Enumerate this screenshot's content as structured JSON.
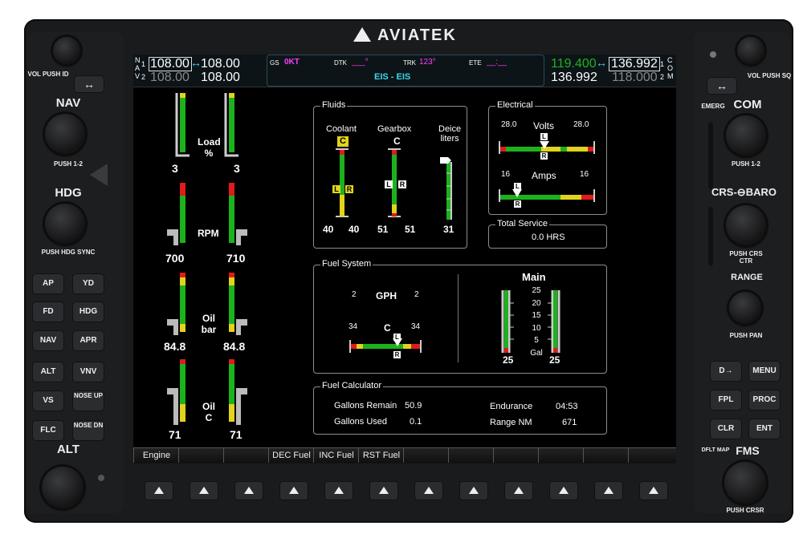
{
  "brand": "AVIATEK",
  "bezel_left": {
    "vol_label": "VOL PUSH ID",
    "swap_icon": "swap-arrows-icon",
    "nav_label": "NAV",
    "nav_push": "PUSH 1-2",
    "hdg_label": "HDG",
    "hdg_push": "PUSH HDG SYNC",
    "buttons": [
      "AP",
      "YD",
      "FD",
      "HDG",
      "NAV",
      "APR",
      "ALT",
      "VNV",
      "VS",
      "NOSE UP",
      "FLC",
      "NOSE DN"
    ],
    "alt_label": "ALT"
  },
  "bezel_right": {
    "vol_label": "VOL PUSH SQ",
    "emerg_label": "EMERG",
    "com_label": "COM",
    "com_push": "PUSH 1-2",
    "crs_label": "CRS",
    "baro_label": "BARO",
    "crs_push": "PUSH CRS CTR",
    "range_label": "RANGE",
    "range_push": "PUSH PAN",
    "buttons": [
      "D→",
      "MENU",
      "FPL",
      "PROC",
      "CLR",
      "ENT"
    ],
    "dflt_map": "DFLT MAP",
    "fms_label": "FMS",
    "push_crsr": "PUSH CRSR"
  },
  "topbar": {
    "nav_tag": [
      "N",
      "A",
      "V"
    ],
    "nav_idx": [
      "1",
      "2"
    ],
    "nav1_active": "108.00",
    "nav1_standby": "108.00",
    "nav2_active": "108.00",
    "nav2_standby": "108.00",
    "gs_label": "GS",
    "gs_val": "0KT",
    "dtk_label": "DTK",
    "dtk_val": "___°",
    "trk_label": "TRK",
    "trk_val": "123°",
    "ete_label": "ETE",
    "ete_val": "__:__",
    "page_title": "EIS - EIS",
    "com1_active": "119.400",
    "com1_standby": "136.992",
    "com2_active": "136.992",
    "com2_standby": "118.000",
    "com_tag": [
      "C",
      "O",
      "M"
    ],
    "com_idx": [
      "1",
      "2"
    ]
  },
  "gauges": {
    "load": {
      "label1": "Load",
      "label2": "%",
      "left": "3",
      "right": "3"
    },
    "rpm": {
      "label": "RPM",
      "left": "700",
      "right": "710"
    },
    "oil_bar": {
      "label1": "Oil",
      "label2": "bar",
      "left": "84.8",
      "right": "84.8"
    },
    "oil_c": {
      "label1": "Oil",
      "label2": "C",
      "left": "71",
      "right": "71"
    }
  },
  "fluids": {
    "title": "Fluids",
    "coolant": "Coolant",
    "coolant_unit": "C",
    "gearbox": "Gearbox",
    "gearbox_unit": "C",
    "deice": "Deice",
    "deice_unit": "liters",
    "coolant_l": "40",
    "coolant_r": "40",
    "gear_l": "51",
    "gear_r": "51",
    "deice_val": "31",
    "L": "L",
    "R": "R"
  },
  "electrical": {
    "title": "Electrical",
    "volts": "Volts",
    "volts_l": "28.0",
    "volts_r": "28.0",
    "amps": "Amps",
    "amps_l": "16",
    "amps_r": "16"
  },
  "total_service": {
    "title": "Total Service",
    "value": "0.0 HRS"
  },
  "fuel_system": {
    "title": "Fuel System",
    "gph": "GPH",
    "gph_l": "2",
    "gph_r": "2",
    "c": "C",
    "c_l": "34",
    "c_r": "34",
    "main": "Main",
    "scale": [
      "25",
      "20",
      "15",
      "10",
      "5",
      "Gal"
    ],
    "left_qty": "25",
    "right_qty": "25"
  },
  "fuel_calc": {
    "title": "Fuel Calculator",
    "remain_label": "Gallons Remain",
    "remain_val": "50.9",
    "used_label": "Gallons Used",
    "used_val": "0.1",
    "endurance_label": "Endurance",
    "endurance_val": "04:53",
    "range_label": "Range NM",
    "range_val": "671"
  },
  "softkeys": [
    "Engine",
    "",
    "",
    "DEC Fuel",
    "INC Fuel",
    "RST Fuel",
    "",
    "",
    "",
    "",
    "",
    ""
  ],
  "colors": {
    "green": "#1db21d",
    "magenta": "#ff3dff",
    "cyan": "#3fd6e6",
    "red": "#e01b1b",
    "yellow": "#e2d31c"
  }
}
